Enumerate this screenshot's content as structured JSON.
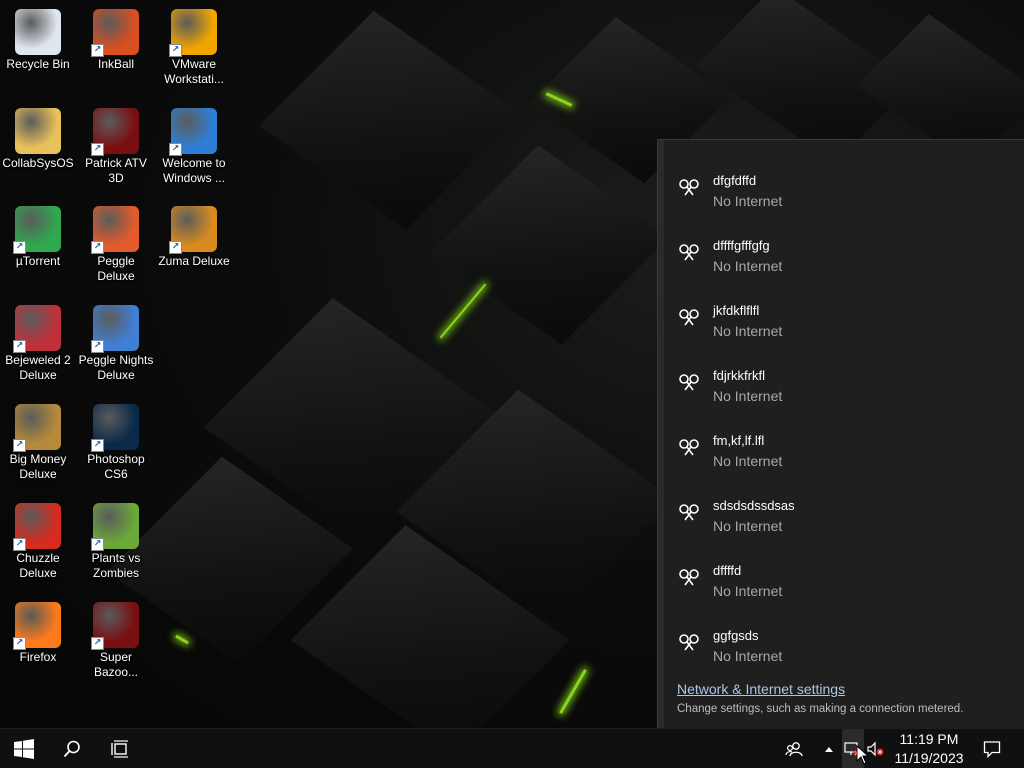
{
  "desktop": {
    "icons": [
      {
        "label": "Recycle Bin",
        "icon": "recycle-bin-icon",
        "color": "#dfe6ee"
      },
      {
        "label": "InkBall",
        "icon": "inkball-icon",
        "color": "#d94f21"
      },
      {
        "label": "VMware Workstati...",
        "icon": "vmware-icon",
        "color": "#f0a500"
      },
      {
        "label": "CollabSysOS",
        "icon": "folder-icon",
        "color": "#e8c15a"
      },
      {
        "label": "Patrick ATV 3D",
        "icon": "flash-icon",
        "color": "#7a0f12"
      },
      {
        "label": "Welcome to Windows ...",
        "icon": "windows-orb-icon",
        "color": "#2d7fd6"
      },
      {
        "label": "µTorrent",
        "icon": "utorrent-icon",
        "color": "#2fa84f"
      },
      {
        "label": "Peggle Deluxe",
        "icon": "peggle-icon",
        "color": "#e25b2c"
      },
      {
        "label": "Zuma Deluxe",
        "icon": "zuma-icon",
        "color": "#d98b1e"
      },
      {
        "label": "Bejeweled 2 Deluxe",
        "icon": "bejeweled-icon",
        "color": "#c0303a"
      },
      {
        "label": "Peggle Nights Deluxe",
        "icon": "peggle-nights-icon",
        "color": "#3f7fd4"
      },
      {
        "label": "Big Money Deluxe",
        "icon": "money-bag-icon",
        "color": "#b58a3a"
      },
      {
        "label": "Photoshop CS6",
        "icon": "photoshop-icon",
        "color": "#0b2a4a"
      },
      {
        "label": "Chuzzle Deluxe",
        "icon": "chuzzle-icon",
        "color": "#d62b1f"
      },
      {
        "label": "Plants vs Zombies",
        "icon": "plants-vs-zombies-icon",
        "color": "#6aa83a"
      },
      {
        "label": "Firefox",
        "icon": "firefox-icon",
        "color": "#ff7a1a"
      },
      {
        "label": "Super Bazoo...",
        "icon": "flash-icon",
        "color": "#7a0f12"
      }
    ]
  },
  "network_flyout": {
    "networks": [
      {
        "name": "dfgfdffd",
        "status": "No Internet"
      },
      {
        "name": "dffffgfffgfg",
        "status": "No Internet"
      },
      {
        "name": "jkfdkflflfl",
        "status": "No Internet"
      },
      {
        "name": "fdjrkkfrkfl",
        "status": "No Internet"
      },
      {
        "name": "fm,kf,lf.lfl",
        "status": "No Internet"
      },
      {
        "name": "sdsdsdssdsas",
        "status": "No Internet"
      },
      {
        "name": "dffffd",
        "status": "No Internet"
      },
      {
        "name": "ggfgsds",
        "status": "No Internet"
      }
    ],
    "settings_link": "Network & Internet settings",
    "settings_desc": "Change settings, such as making a connection metered."
  },
  "taskbar": {
    "time": "11:19 PM",
    "date": "11/19/2023"
  },
  "colors": {
    "accent_glow": "#8cd41c",
    "flyout_bg": "#1f1f1f",
    "link": "#a9c7e8"
  }
}
